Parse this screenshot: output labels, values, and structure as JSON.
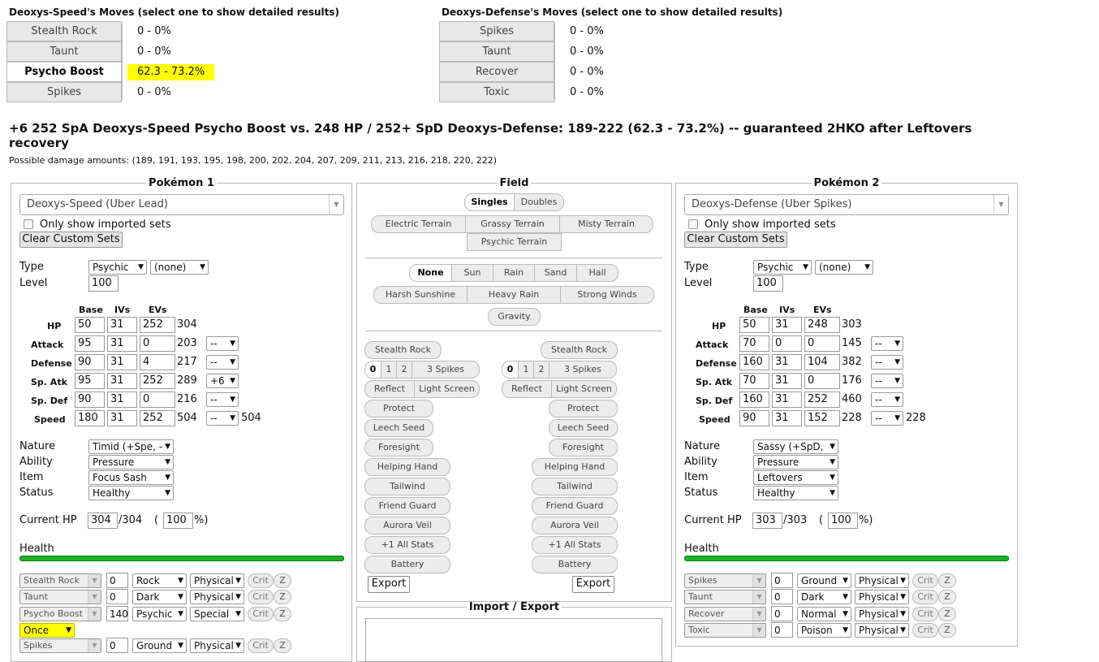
{
  "p1_moves_header": "Deoxys-Speed's Moves (select one to show detailed results)",
  "p2_moves_header": "Deoxys-Defense's Moves (select one to show detailed results)",
  "p1_moves": [
    {
      "name": "Stealth Rock",
      "pct": "0 - 0%"
    },
    {
      "name": "Taunt",
      "pct": "0 - 0%"
    },
    {
      "name": "Psycho Boost",
      "pct": "62.3 - 73.2%"
    },
    {
      "name": "Spikes",
      "pct": "0 - 0%"
    }
  ],
  "p2_moves": [
    {
      "name": "Spikes",
      "pct": "0 - 0%"
    },
    {
      "name": "Taunt",
      "pct": "0 - 0%"
    },
    {
      "name": "Recover",
      "pct": "0 - 0%"
    },
    {
      "name": "Toxic",
      "pct": "0 - 0%"
    }
  ],
  "result_line1": "+6 252 SpA Deoxys-Speed Psycho Boost vs. 248 HP / 252+ SpD Deoxys-Defense: 189-222 (62.3 - 73.2%) -- guaranteed 2HKO after Leftovers",
  "result_line2": "recovery",
  "damage_amounts": "Possible damage amounts: (189, 191, 193, 195, 198, 200, 202, 204, 207, 209, 211, 213, 216, 218, 220, 222)",
  "labels": {
    "pokemon1": "Pokémon 1",
    "pokemon2": "Pokémon 2",
    "field": "Field",
    "import_export": "Import / Export",
    "only_imported": "Only show imported sets",
    "clear_sets": "Clear Custom Sets",
    "type": "Type",
    "level": "Level",
    "base": "Base",
    "ivs": "IVs",
    "evs": "EVs",
    "nature": "Nature",
    "ability": "Ability",
    "item": "Item",
    "status": "Status",
    "current_hp": "Current HP",
    "health": "Health",
    "crit": "Crit",
    "z": "Z",
    "stat_names": [
      "HP",
      "Attack",
      "Defense",
      "Sp. Atk",
      "Sp. Def",
      "Speed"
    ]
  },
  "p1": {
    "set": "Deoxys-Speed (Uber Lead)",
    "type1": "Psychic",
    "type2": "(none)",
    "level": "100",
    "stats": [
      {
        "base": "50",
        "iv": "31",
        "ev": "252",
        "total": "304",
        "boost": ""
      },
      {
        "base": "95",
        "iv": "31",
        "ev": "0",
        "total": "203",
        "boost": "--"
      },
      {
        "base": "90",
        "iv": "31",
        "ev": "4",
        "total": "217",
        "boost": "--"
      },
      {
        "base": "95",
        "iv": "31",
        "ev": "252",
        "total": "289",
        "boost": "+6"
      },
      {
        "base": "90",
        "iv": "31",
        "ev": "0",
        "total": "216",
        "boost": "--"
      },
      {
        "base": "180",
        "iv": "31",
        "ev": "252",
        "total": "504",
        "boost": "--"
      }
    ],
    "speed_final": "504",
    "nature": "Timid (+Spe, -",
    "ability": "Pressure",
    "item": "Focus Sash",
    "status": "Healthy",
    "hp_current": "304",
    "hp_max": "/304",
    "hp_pct": "100",
    "hp_open": "(",
    "hp_close": "%)",
    "health_fraction": 1.0,
    "moves": [
      {
        "name": "Stealth Rock",
        "bp": "0",
        "type": "Rock",
        "cat": "Physical"
      },
      {
        "name": "Taunt",
        "bp": "0",
        "type": "Dark",
        "cat": "Physical"
      },
      {
        "name": "Psycho Boost",
        "bp": "140",
        "type": "Psychic",
        "cat": "Special"
      },
      {
        "name": "Spikes",
        "bp": "0",
        "type": "Ground",
        "cat": "Physical"
      }
    ],
    "hits_select": "Once"
  },
  "p2": {
    "set": "Deoxys-Defense (Uber Spikes)",
    "type1": "Psychic",
    "type2": "(none)",
    "level": "100",
    "stats": [
      {
        "base": "50",
        "iv": "31",
        "ev": "248",
        "total": "303",
        "boost": ""
      },
      {
        "base": "70",
        "iv": "0",
        "ev": "0",
        "total": "145",
        "boost": "--"
      },
      {
        "base": "160",
        "iv": "31",
        "ev": "104",
        "total": "382",
        "boost": "--"
      },
      {
        "base": "70",
        "iv": "31",
        "ev": "0",
        "total": "176",
        "boost": "--"
      },
      {
        "base": "160",
        "iv": "31",
        "ev": "252",
        "total": "460",
        "boost": "--"
      },
      {
        "base": "90",
        "iv": "31",
        "ev": "152",
        "total": "228",
        "boost": "--"
      }
    ],
    "speed_final": "228",
    "nature": "Sassy (+SpD,",
    "ability": "Pressure",
    "item": "Leftovers",
    "status": "Healthy",
    "hp_current": "303",
    "hp_max": "/303",
    "hp_pct": "100",
    "hp_open": "(",
    "hp_close": "%)",
    "health_fraction": 1.0,
    "moves": [
      {
        "name": "Spikes",
        "bp": "0",
        "type": "Ground",
        "cat": "Physical"
      },
      {
        "name": "Taunt",
        "bp": "0",
        "type": "Dark",
        "cat": "Physical"
      },
      {
        "name": "Recover",
        "bp": "0",
        "type": "Normal",
        "cat": "Physical"
      },
      {
        "name": "Toxic",
        "bp": "0",
        "type": "Poison",
        "cat": "Physical"
      }
    ]
  },
  "field": {
    "format": [
      "Singles",
      "Doubles"
    ],
    "terrain": [
      "Electric Terrain",
      "Grassy Terrain",
      "Misty Terrain",
      "Psychic Terrain"
    ],
    "weather": [
      "None",
      "Sun",
      "Rain",
      "Sand",
      "Hail"
    ],
    "weather2": [
      "Harsh Sunshine",
      "Heavy Rain",
      "Strong Winds"
    ],
    "gravity": "Gravity",
    "stealth_rock": "Stealth Rock",
    "spikes": [
      "0",
      "1",
      "2",
      "3 Spikes"
    ],
    "reflect": "Reflect",
    "light_screen": "Light Screen",
    "side_buttons": [
      "Protect",
      "Leech Seed",
      "Foresight",
      "Helping Hand",
      "Tailwind",
      "Friend Guard",
      "Aurora Veil",
      "+1 All Stats",
      "Battery"
    ],
    "export": "Export"
  }
}
